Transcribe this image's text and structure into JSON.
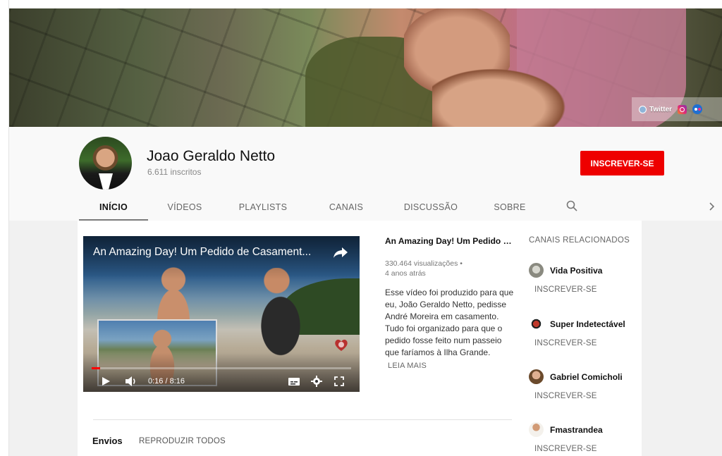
{
  "banner": {
    "links": [
      {
        "label": "Twitter",
        "icon": "twitter-icon"
      },
      {
        "label": "",
        "icon": "instagram-icon"
      },
      {
        "label": "",
        "icon": "flickr-icon"
      }
    ]
  },
  "channel": {
    "name": "Joao Geraldo Netto",
    "subscribers": "6.611 inscritos",
    "subscribe_label": "INSCREVER-SE",
    "subscribe_color": "#ee0000"
  },
  "tabs": [
    {
      "label": "INÍCIO",
      "active": true
    },
    {
      "label": "VÍDEOS",
      "active": false
    },
    {
      "label": "PLAYLISTS",
      "active": false
    },
    {
      "label": "CANAIS",
      "active": false
    },
    {
      "label": "DISCUSSÃO",
      "active": false
    },
    {
      "label": "SOBRE",
      "active": false
    }
  ],
  "featured": {
    "player_title": "An Amazing Day! Um Pedido de Casament...",
    "time": "0:16 / 8:16",
    "progress_fraction": 0.032,
    "title": "An Amazing Day! Um Pedido de Casamento",
    "views": "330.464 visualizações •",
    "age": "4 anos atrás",
    "description": "Esse vídeo foi produzido para que eu, João Geraldo Netto, pedisse André Moreira em casamento. Tudo foi organizado para que o pedido fosse feito num passeio que faríamos à Ilha Grande.",
    "read_more": "LEIA MAIS"
  },
  "uploads": {
    "label": "Envios",
    "play_all": "REPRODUZIR TODOS"
  },
  "related": {
    "heading": "CANAIS RELACIONADOS",
    "channels": [
      {
        "name": "Vida Positiva",
        "action": "INSCREVER-SE",
        "avatar_color": "#a9a9a0"
      },
      {
        "name": "Super Indetectável",
        "action": "INSCREVER-SE",
        "avatar_color": "#c0392b"
      },
      {
        "name": "Gabriel Comicholi",
        "action": "INSCREVER-SE",
        "avatar_color": "#c99a78"
      },
      {
        "name": "Fmastrandea",
        "action": "INSCREVER-SE",
        "avatar_color": "#b98461"
      }
    ]
  }
}
